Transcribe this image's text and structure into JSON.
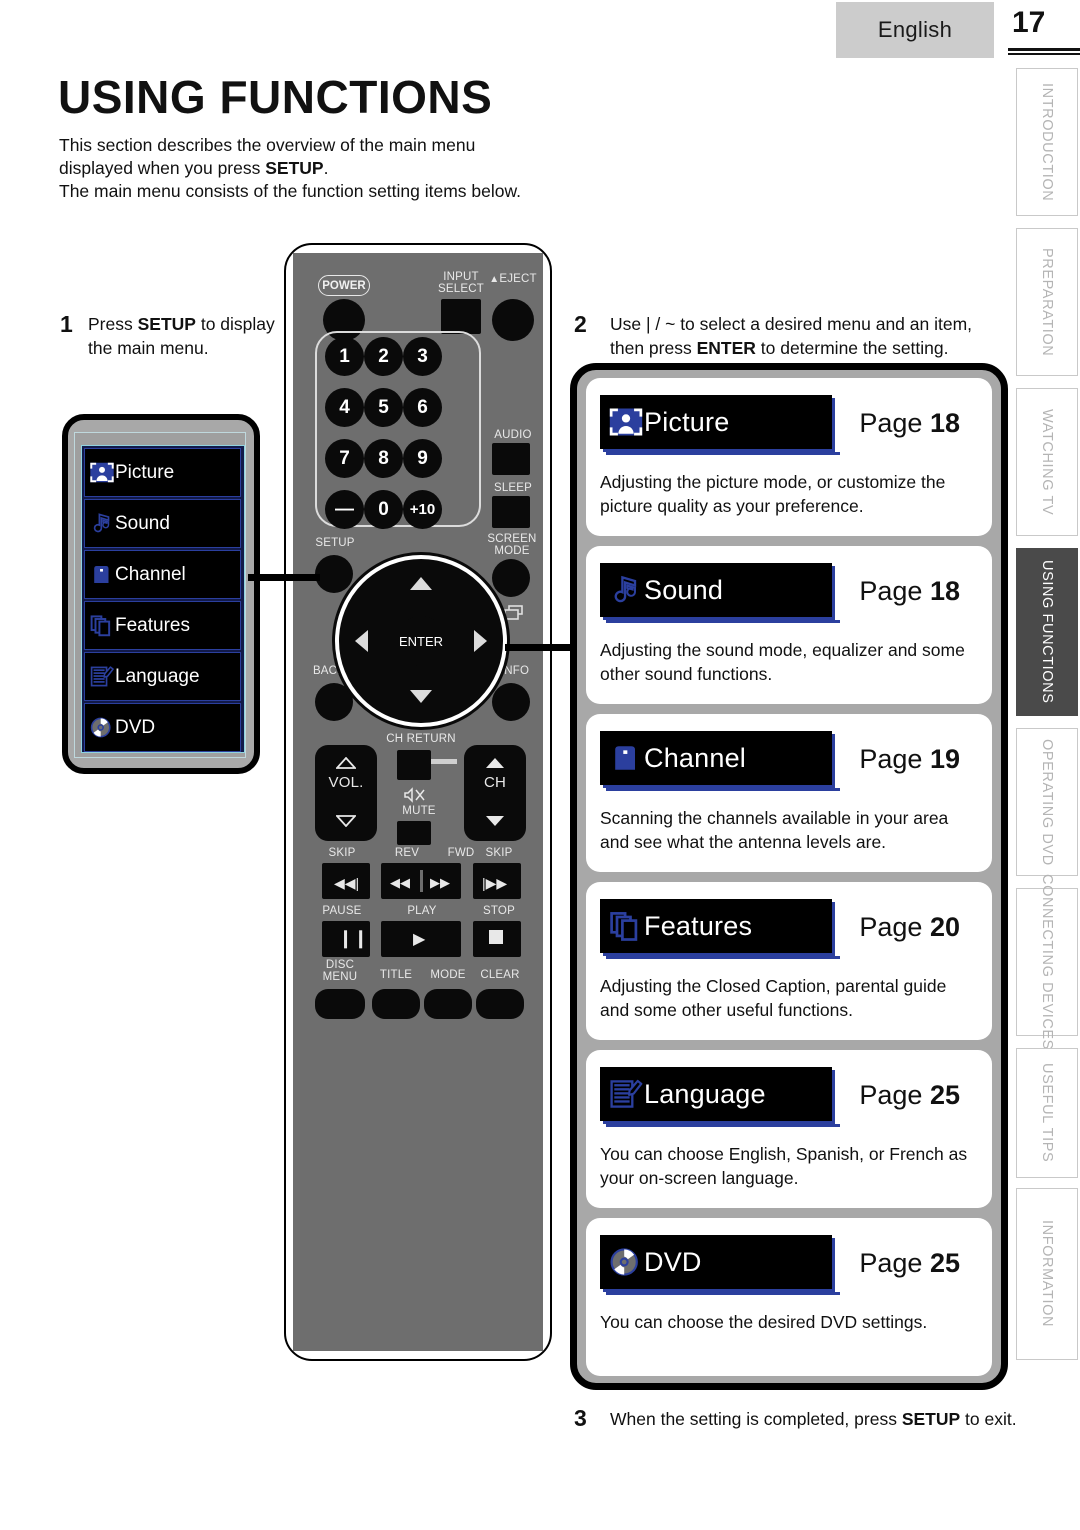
{
  "header": {
    "language_label": "English",
    "page_number": "17"
  },
  "tabs": [
    {
      "label": "INTRODUCTION",
      "active": false
    },
    {
      "label": "PREPARATION",
      "active": false
    },
    {
      "label": "WATCHING TV",
      "active": false
    },
    {
      "label": "USING FUNCTIONS",
      "active": true
    },
    {
      "label": "OPERATING DVD",
      "active": false
    },
    {
      "label": "CONNECTING DEVICES",
      "active": false
    },
    {
      "label": "USEFUL TIPS",
      "active": false
    },
    {
      "label": "INFORMATION",
      "active": false
    }
  ],
  "title": "USING FUNCTIONS",
  "intro_line1": "This section describes the overview of the main menu",
  "intro_line2_pre": "displayed when you press ",
  "intro_line2_bold": "SETUP",
  "intro_line2_post": ".",
  "intro_line3": "The main menu consists of the function setting items below.",
  "steps": {
    "one_num": "1",
    "one_pre": "Press ",
    "one_bold": "SETUP",
    "one_post": " to display the main menu.",
    "two_num": "2",
    "two_pre": "Use  |  /  ~  to select a desired menu and an item, then press ",
    "two_bold": "ENTER",
    "two_post": " to determine the setting.",
    "three_num": "3",
    "three_pre": "When the setting is completed, press ",
    "three_bold": "SETUP",
    "three_post": " to exit."
  },
  "osd_menu": {
    "items": [
      {
        "label": "Picture",
        "icon": "picture-icon"
      },
      {
        "label": "Sound",
        "icon": "sound-icon"
      },
      {
        "label": "Channel",
        "icon": "channel-icon"
      },
      {
        "label": "Features",
        "icon": "features-icon"
      },
      {
        "label": "Language",
        "icon": "language-icon"
      },
      {
        "label": "DVD",
        "icon": "dvd-icon"
      }
    ]
  },
  "remote": {
    "power": "POWER",
    "input_select_line1": "INPUT",
    "input_select_line2": "SELECT",
    "eject": "EJECT",
    "eject_glyph": "▲",
    "keys": [
      "1",
      "2",
      "3",
      "4",
      "5",
      "6",
      "7",
      "8",
      "9",
      "—",
      "0",
      "+10"
    ],
    "audio": "AUDIO",
    "sleep": "SLEEP",
    "screen_mode_line1": "SCREEN",
    "screen_mode_line2": "MODE",
    "setup": "SETUP",
    "enter": "ENTER",
    "back": "BACK",
    "info": "INFO",
    "ch_return": "CH RETURN",
    "vol": "VOL.",
    "mute": "MUTE",
    "ch": "CH",
    "skip_left": "SKIP",
    "rev": "REV",
    "fwd": "FWD",
    "skip_right": "SKIP",
    "pause": "PAUSE",
    "play": "PLAY",
    "stop": "STOP",
    "disc_menu_line1": "DISC",
    "disc_menu_line2": "MENU",
    "title": "TITLE",
    "mode": "MODE",
    "clear": "CLEAR"
  },
  "cards": [
    {
      "name": "Picture",
      "icon": "picture-icon",
      "page_prefix": "Page ",
      "page_number": "18",
      "description": "Adjusting the picture mode, or customize the picture quality as your preference."
    },
    {
      "name": "Sound",
      "icon": "sound-icon",
      "page_prefix": "Page ",
      "page_number": "18",
      "description": "Adjusting the sound mode, equalizer and some other sound functions."
    },
    {
      "name": "Channel",
      "icon": "channel-icon",
      "page_prefix": "Page ",
      "page_number": "19",
      "description": "Scanning the channels available in your area and see what the antenna levels are."
    },
    {
      "name": "Features",
      "icon": "features-icon",
      "page_prefix": "Page ",
      "page_number": "20",
      "description": "Adjusting the Closed Caption, parental guide and some other useful functions."
    },
    {
      "name": "Language",
      "icon": "language-icon",
      "page_prefix": "Page ",
      "page_number": "25",
      "description": "You can choose English, Spanish, or French as your on-screen language."
    },
    {
      "name": "DVD",
      "icon": "dvd-icon",
      "page_prefix": "Page ",
      "page_number": "25",
      "description": "You can choose the desired DVD settings."
    }
  ],
  "colors": {
    "accent_blue": "#2b3f9e",
    "osd_bg": "#121a4a",
    "tab_active_bg": "#4a4a4a",
    "lang_box_bg": "#cccccc",
    "remote_body": "#6e6e6e"
  }
}
